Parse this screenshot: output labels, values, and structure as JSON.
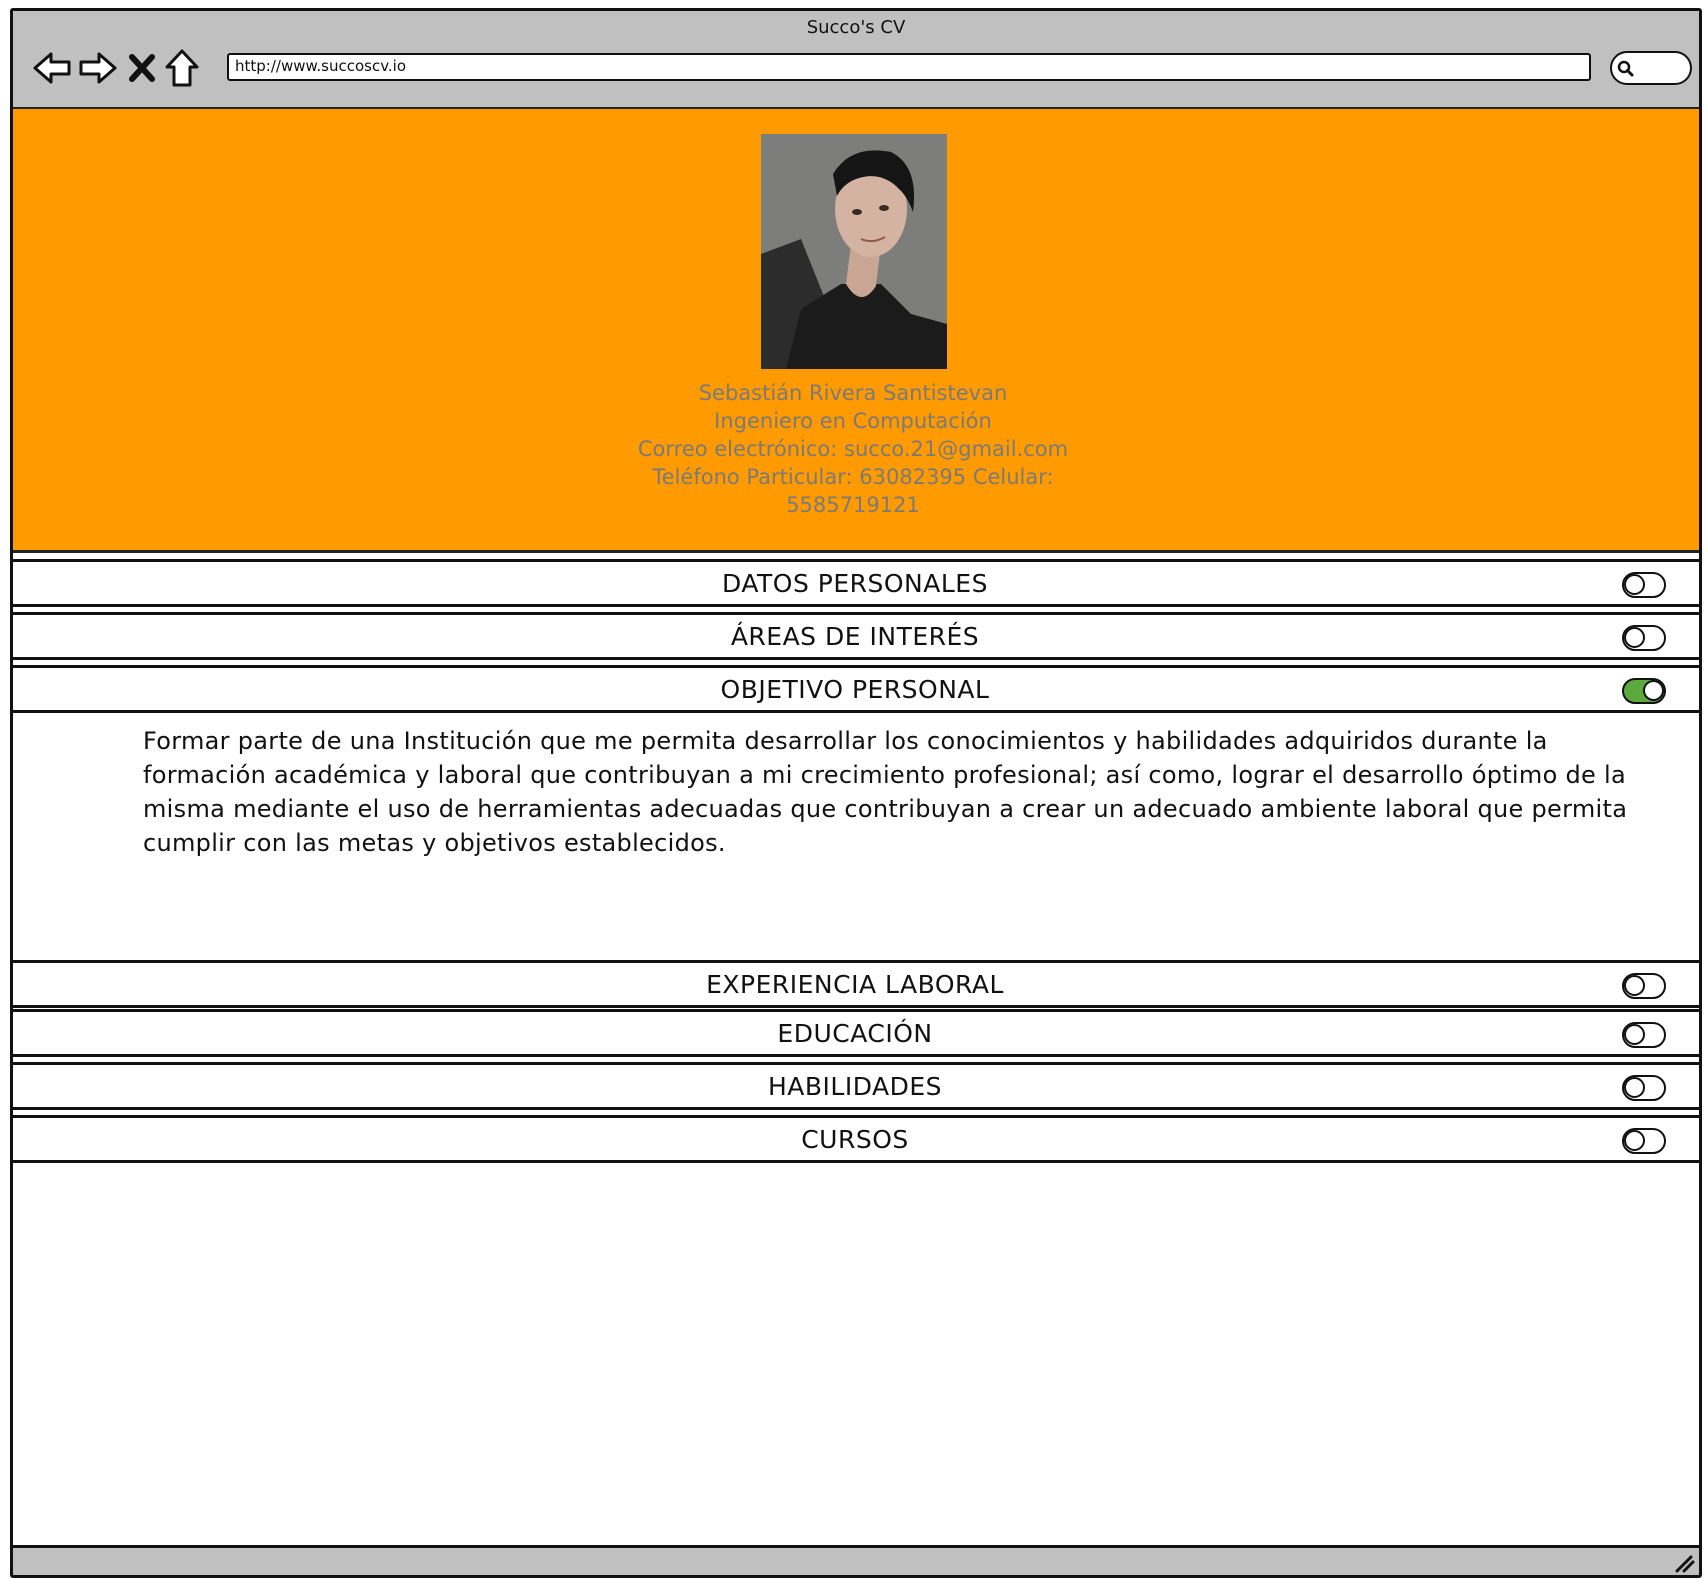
{
  "window": {
    "title": "Succo's CV",
    "url": "http://www.succoscv.io"
  },
  "nav": {
    "back_icon": "arrow-left-icon",
    "forward_icon": "arrow-right-icon",
    "stop_icon": "close-icon",
    "home_icon": "home-icon",
    "search_icon": "search-icon"
  },
  "profile": {
    "name": "Sebastián Rivera Santistevan",
    "title": "Ingeniero en Computación",
    "email_line": "Correo electrónico: succo.21@gmail.com",
    "phone_line": "Teléfono Particular: 63082395 Celular:",
    "mobile": "5585719121"
  },
  "sections": [
    {
      "label": "DATOS PERSONALES",
      "expanded": false
    },
    {
      "label": "ÁREAS DE INTERÉS",
      "expanded": false
    },
    {
      "label": "OBJETIVO PERSONAL",
      "expanded": true
    },
    {
      "label": "EXPERIENCIA LABORAL",
      "expanded": false
    },
    {
      "label": "EDUCACIÓN",
      "expanded": false
    },
    {
      "label": "HABILIDADES",
      "expanded": false
    },
    {
      "label": "CURSOS",
      "expanded": false
    }
  ],
  "objective_text": "Formar parte de una Institución que me permita desarrollar los  conocimientos y habilidades adquiridos durante la formación académica y laboral que contribuyan a  mi crecimiento profesional; así como, lograr el desarrollo óptimo de la misma mediante el uso de herramientas adecuadas que contribuyan a crear un adecuado  ambiente laboral que permita cumplir con las metas y objetivos establecidos.",
  "colors": {
    "header_bg": "#ff9a00",
    "chrome_bg": "#c0c0c0",
    "toggle_on": "#5caa3f",
    "profile_text": "#7a7a7a"
  }
}
